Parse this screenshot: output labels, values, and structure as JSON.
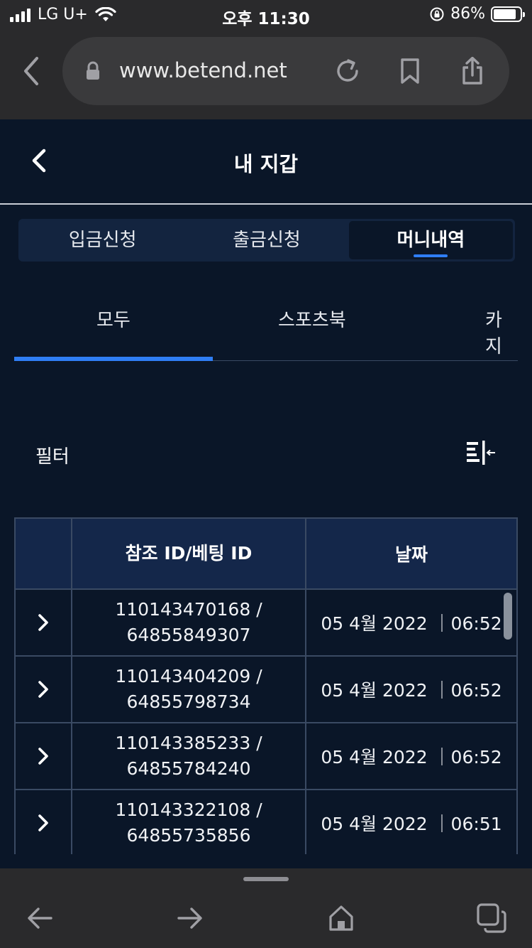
{
  "status_bar": {
    "carrier": "LG U+",
    "time": "오후 11:30",
    "battery_percent": "86%",
    "battery_level": 0.86
  },
  "browser": {
    "url": "www.betend.net",
    "icons": [
      "back-icon",
      "lock-icon",
      "reload-icon",
      "bookmark-icon",
      "share-icon"
    ]
  },
  "header": {
    "title": "내 지갑"
  },
  "segments": [
    {
      "label": "입금신청",
      "active": false
    },
    {
      "label": "출금신청",
      "active": false
    },
    {
      "label": "머니내역",
      "active": true
    }
  ],
  "subtabs": [
    {
      "label": "모두",
      "active": true
    },
    {
      "label": "스포츠북",
      "active": false
    },
    {
      "label": "카지",
      "active": false
    }
  ],
  "filter": {
    "label": "필터"
  },
  "table": {
    "headers": [
      "",
      "참조 ID/베팅 ID",
      "날짜"
    ],
    "rows": [
      {
        "ref_id": "110143470168 /",
        "bet_id": "64855849307",
        "date": "05 4월 2022 ｜06:52"
      },
      {
        "ref_id": "110143404209 /",
        "bet_id": "64855798734",
        "date": "05 4월 2022 ｜06:52"
      },
      {
        "ref_id": "110143385233 /",
        "bet_id": "64855784240",
        "date": "05 4월 2022 ｜06:52"
      },
      {
        "ref_id": "110143322108 /",
        "bet_id": "64855735856",
        "date": "05 4월 2022 ｜06:51"
      }
    ]
  },
  "colors": {
    "background": "#0a1628",
    "accent": "#2f7ef5",
    "table_header": "#14274a",
    "browser_chrome": "#2a2a2c"
  }
}
